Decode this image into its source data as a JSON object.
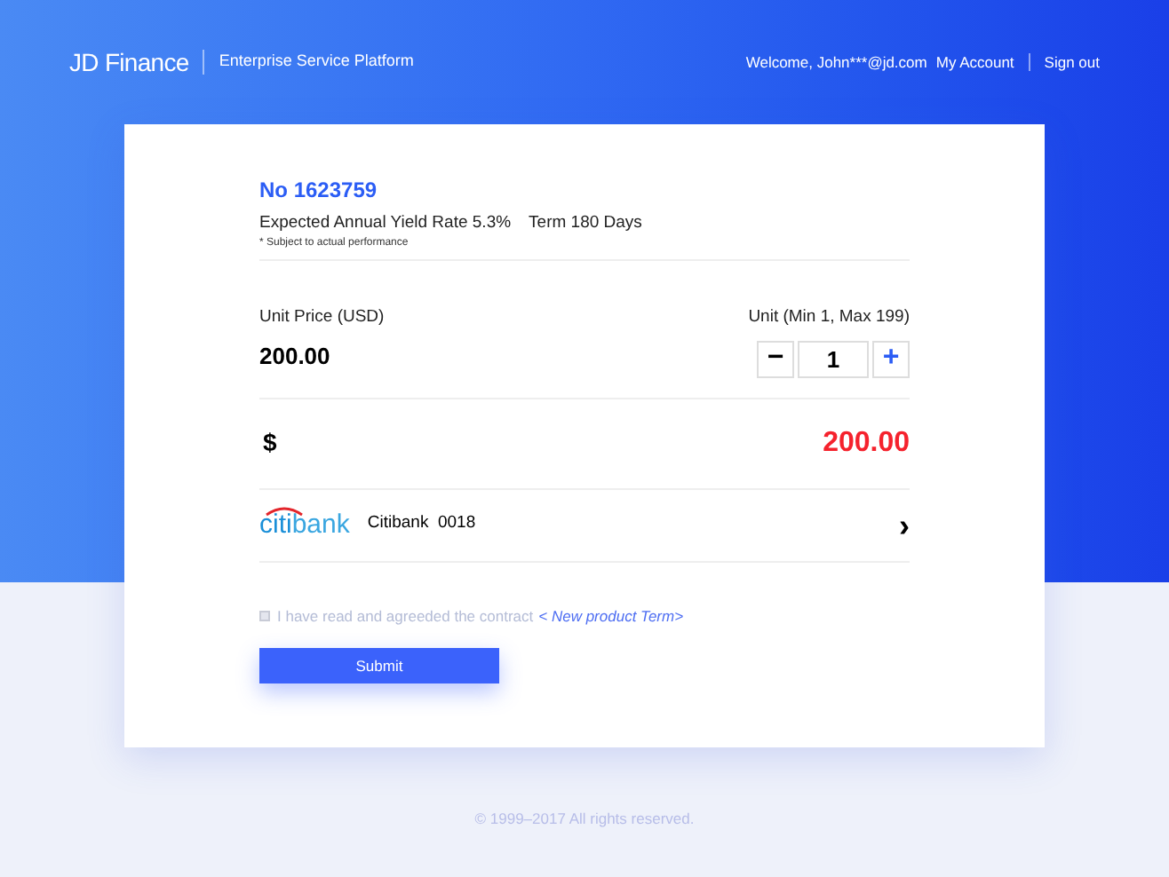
{
  "header": {
    "brand": "JD Finance",
    "platform": "Enterprise Service Platform",
    "welcome": "Welcome, John***@jd.com",
    "links": [
      "My Account",
      "Sign out"
    ]
  },
  "product": {
    "number": "No 1623759",
    "yield": "Expected Annual Yield Rate 5.3%",
    "term": "Term 180 Days",
    "note": "* Subject to actual performance"
  },
  "price": {
    "label": "Unit Price (USD)",
    "value": "200.00"
  },
  "unit": {
    "label": "Unit (Min 1, Max 199)",
    "minus": "−",
    "value": "1",
    "plus": "+"
  },
  "total": {
    "currency": "$",
    "amount": "200.00"
  },
  "payment": {
    "logo_left": "citi",
    "logo_right": "bank",
    "account": "Citibank  0018",
    "chevron": "›"
  },
  "agreement": {
    "checked": false,
    "text": "I have read and agreeded the contract",
    "link": "< New product Term>"
  },
  "submit": "Submit",
  "footer": "© 1999–2017 All rights reserved."
}
